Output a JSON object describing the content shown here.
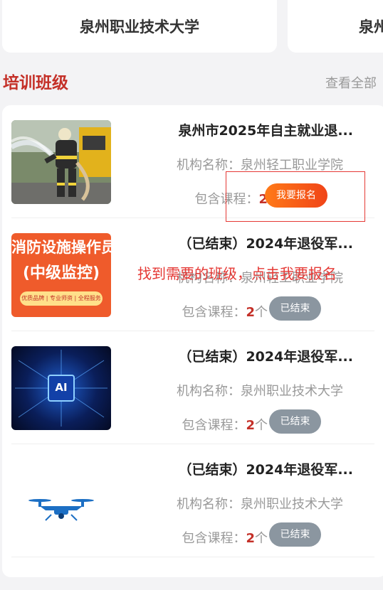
{
  "schools": [
    {
      "name": "泉州职业技术大学"
    },
    {
      "name": "泉州"
    }
  ],
  "section": {
    "title": "培训班级",
    "view_all": "查看全部"
  },
  "labels": {
    "org_prefix": "机构名称：",
    "courses_prefix": "包含课程：",
    "courses_unit": "个"
  },
  "classes": [
    {
      "title": "泉州市2025年自主就业退...",
      "org": "泉州轻工职业学院",
      "course_count": "2",
      "action": "我要报名",
      "thumb": "firefighter-photo"
    },
    {
      "title": "（已结束）2024年退役军...",
      "org": "泉州轻工职业学院",
      "course_count": "2",
      "action": "已结束",
      "thumb": "fire-safety-poster",
      "poster": {
        "line1": "消防设施操作员",
        "line2": "(中级监控)",
        "footer": "优质品牌 | 专业师资 | 全程服务"
      }
    },
    {
      "title": "（已结束）2024年退役军...",
      "org": "泉州职业技术大学",
      "course_count": "2",
      "action": "已结束",
      "thumb": "ai-chip-image",
      "chip_label": "AI"
    },
    {
      "title": "（已结束）2024年退役军...",
      "org": "泉州职业技术大学",
      "course_count": "2",
      "action": "已结束",
      "thumb": "drone-image"
    }
  ],
  "annotation": {
    "text": "找到需要的班级，点击我要报名"
  },
  "colors": {
    "accent": "#c43028",
    "signup": "#f04418",
    "ended": "#8b96a0",
    "annotation": "#e53935"
  }
}
